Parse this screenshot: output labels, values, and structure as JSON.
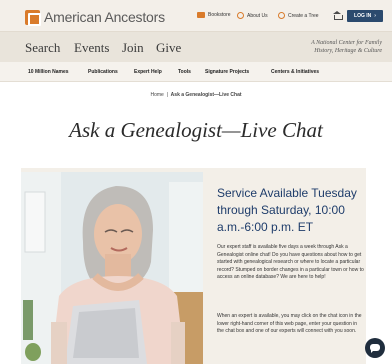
{
  "header": {
    "logo_text": "American Ancestors",
    "utility": {
      "bookstore": "Bookstore",
      "about": "About Us",
      "tree": "Create a Tree"
    },
    "login": "LOG IN"
  },
  "nav": {
    "items": [
      "Search",
      "Events",
      "Join",
      "Give"
    ],
    "tagline_line1": "A National Center for Family",
    "tagline_line2": "History, Heritage & Culture"
  },
  "subnav": {
    "items": [
      "10 Million Names",
      "Publications",
      "Expert Help",
      "Tools",
      "Signature Projects",
      "Centers & Initiatives"
    ]
  },
  "breadcrumb": {
    "home": "Home",
    "sep": "|",
    "current": "Ask a Genealogist—Live Chat"
  },
  "page": {
    "title": "Ask a Genealogist—Live Chat",
    "service": "Service Available Tuesday through Saturday, 10:00 a.m.-6:00 p.m. ET",
    "para1": "Our expert staff is available five days a week through Ask a Genealogist online chat! Do you have questions about how to get started with genealogical research or where to locate a particular record? Stumped on border changes in a particular town or how to access an online database? We are here to help!",
    "para2": "When an expert is available, you may click on the chat icon in the lower right-hand corner of this web page, enter your question in the chat box and one of our experts will connect with you soon."
  },
  "colors": {
    "accent": "#d97b2b",
    "brand_blue": "#1f3d6b",
    "login_bg": "#2b4a6e"
  }
}
